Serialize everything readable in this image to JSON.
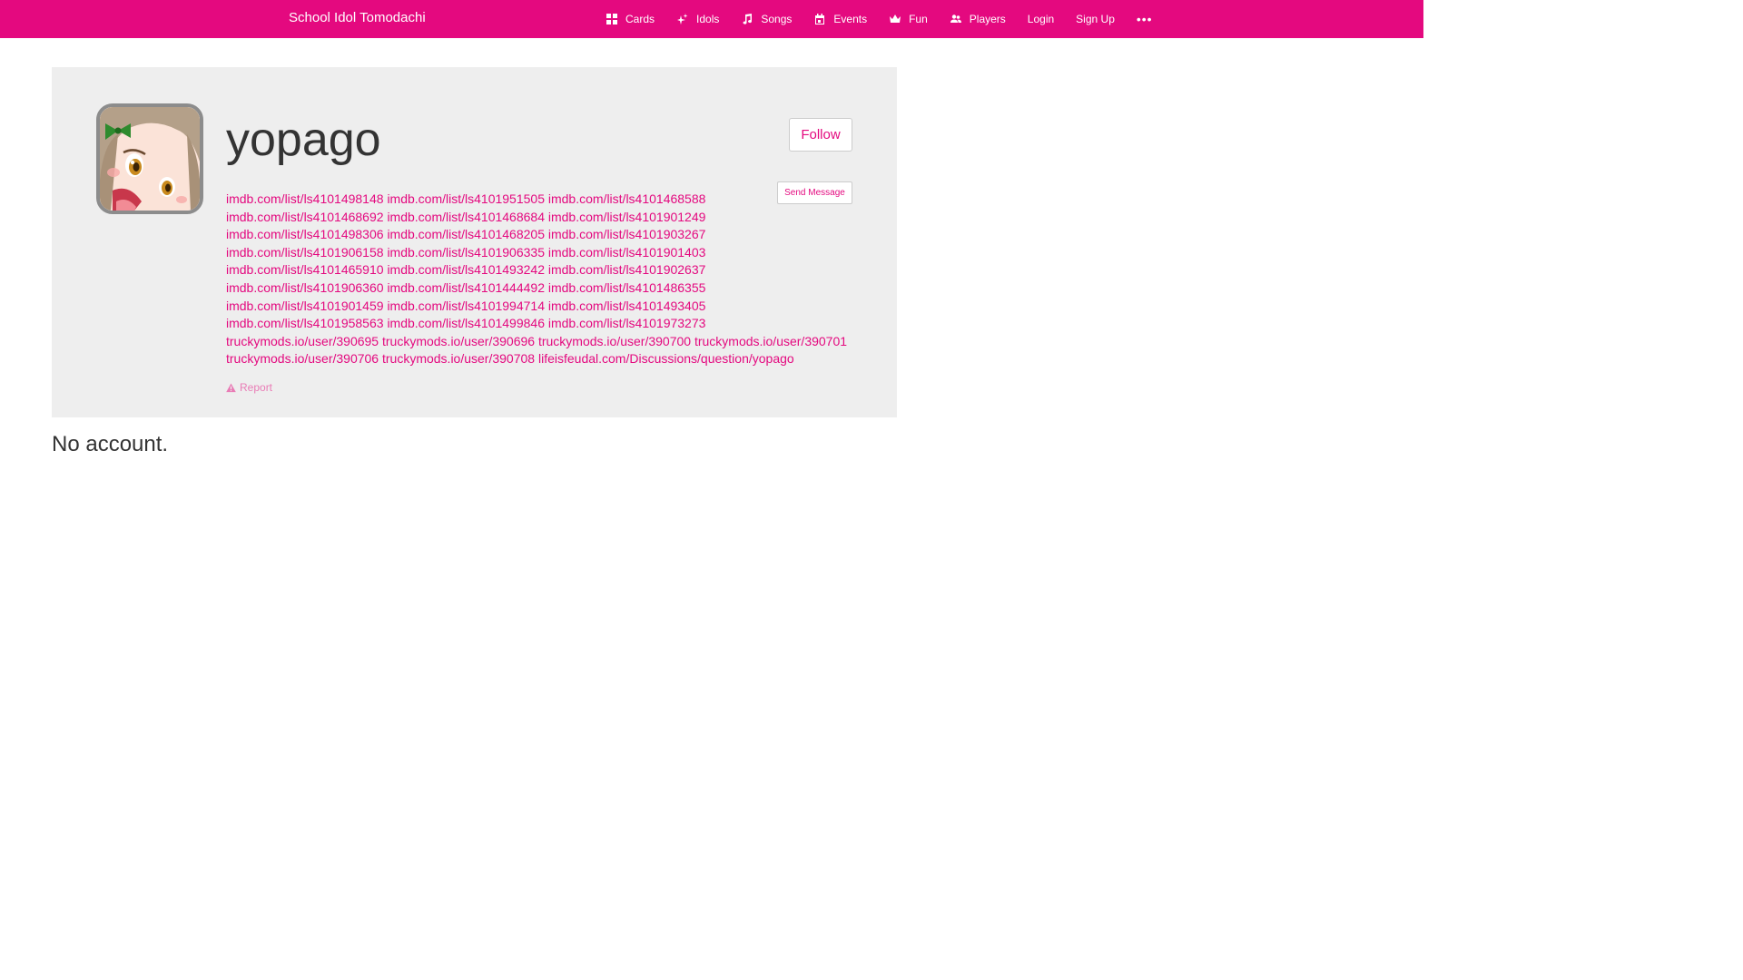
{
  "navbar": {
    "brand": "School Idol Tomodachi",
    "items": [
      {
        "label": "Cards",
        "icon": "cards-icon"
      },
      {
        "label": "Idols",
        "icon": "sparkle-icon"
      },
      {
        "label": "Songs",
        "icon": "music-note-icon"
      },
      {
        "label": "Events",
        "icon": "calendar-icon"
      },
      {
        "label": "Fun",
        "icon": "crown-icon"
      },
      {
        "label": "Players",
        "icon": "players-icon"
      },
      {
        "label": "Login"
      },
      {
        "label": "Sign Up"
      }
    ],
    "more_label": "•••"
  },
  "profile": {
    "username": "yopago",
    "follow_label": "Follow",
    "message_label": "Send Message",
    "report_label": "Report",
    "links": [
      "imdb.com/list/ls4101498148",
      "imdb.com/list/ls4101951505",
      "imdb.com/list/ls4101468588",
      "imdb.com/list/ls4101468692",
      "imdb.com/list/ls4101468684",
      "imdb.com/list/ls4101901249",
      "imdb.com/list/ls4101498306",
      "imdb.com/list/ls4101468205",
      "imdb.com/list/ls4101903267",
      "imdb.com/list/ls4101906158",
      "imdb.com/list/ls4101906335",
      "imdb.com/list/ls4101901403",
      "imdb.com/list/ls4101465910",
      "imdb.com/list/ls4101493242",
      "imdb.com/list/ls4101902637",
      "imdb.com/list/ls4101906360",
      "imdb.com/list/ls4101444492",
      "imdb.com/list/ls4101486355",
      "imdb.com/list/ls4101901459",
      "imdb.com/list/ls4101994714",
      "imdb.com/list/ls4101493405",
      "imdb.com/list/ls4101958563",
      "imdb.com/list/ls4101499846",
      "imdb.com/list/ls4101973273",
      "truckymods.io/user/390695",
      "truckymods.io/user/390696",
      "truckymods.io/user/390700",
      "truckymods.io/user/390701",
      "truckymods.io/user/390706",
      "truckymods.io/user/390708",
      "lifeisfeudal.com/Discussions/question/yopago"
    ]
  },
  "accounts": {
    "empty_message": "No account."
  },
  "colors": {
    "brand": "#e4097f",
    "panel": "#eeeeee"
  }
}
